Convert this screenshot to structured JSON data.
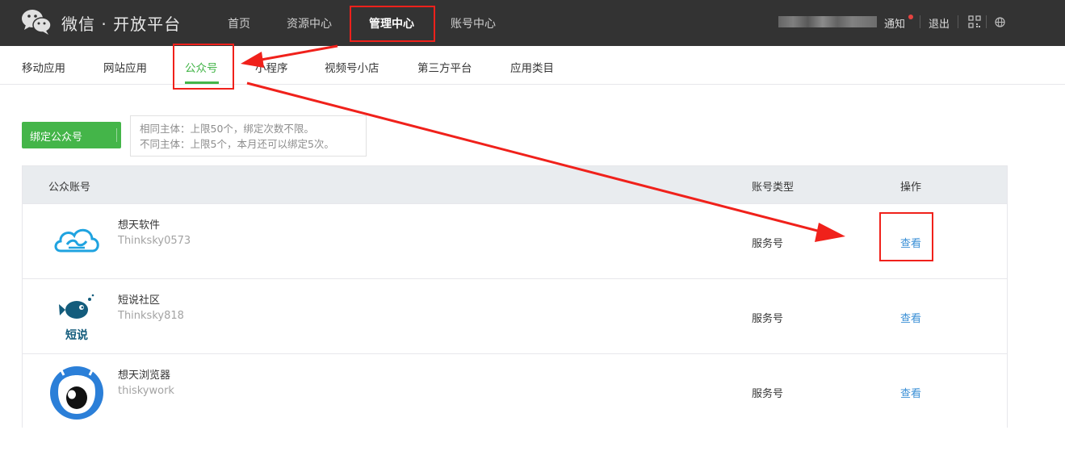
{
  "header": {
    "brand": "微信 · 开放平台",
    "nav": [
      "首页",
      "资源中心",
      "管理中心",
      "账号中心"
    ],
    "active_nav": "管理中心",
    "notice": "通知",
    "logout": "退出"
  },
  "subnav": {
    "items": [
      "移动应用",
      "网站应用",
      "公众号",
      "小程序",
      "视频号小店",
      "第三方平台",
      "应用类目"
    ],
    "active": "公众号"
  },
  "bind": {
    "label": "绑定公众号",
    "hint_1": "相同主体：上限50个，绑定次数不限。",
    "hint_2": "不同主体：上限5个，本月还可以绑定5次。"
  },
  "table": {
    "headers": {
      "account": "公众账号",
      "type": "账号类型",
      "action": "操作"
    },
    "rows": [
      {
        "name": "想天软件",
        "id": "Thinksky0573",
        "type": "服务号",
        "action": "查看"
      },
      {
        "name": "短说社区",
        "id": "Thinksky818",
        "type": "服务号",
        "action": "查看"
      },
      {
        "name": "想天浏览器",
        "id": "thiskywork",
        "type": "服务号",
        "action": "查看"
      }
    ]
  },
  "avatars": {
    "row_2_caption": "短说"
  },
  "colors": {
    "accent": "#44b549",
    "topbar": "#333333",
    "link": "#3a8fd6",
    "annotation": "#f0211b"
  },
  "icons": [
    "wechat-logo-icon",
    "qr-code-icon",
    "globe-icon",
    "chevron-down-icon"
  ]
}
